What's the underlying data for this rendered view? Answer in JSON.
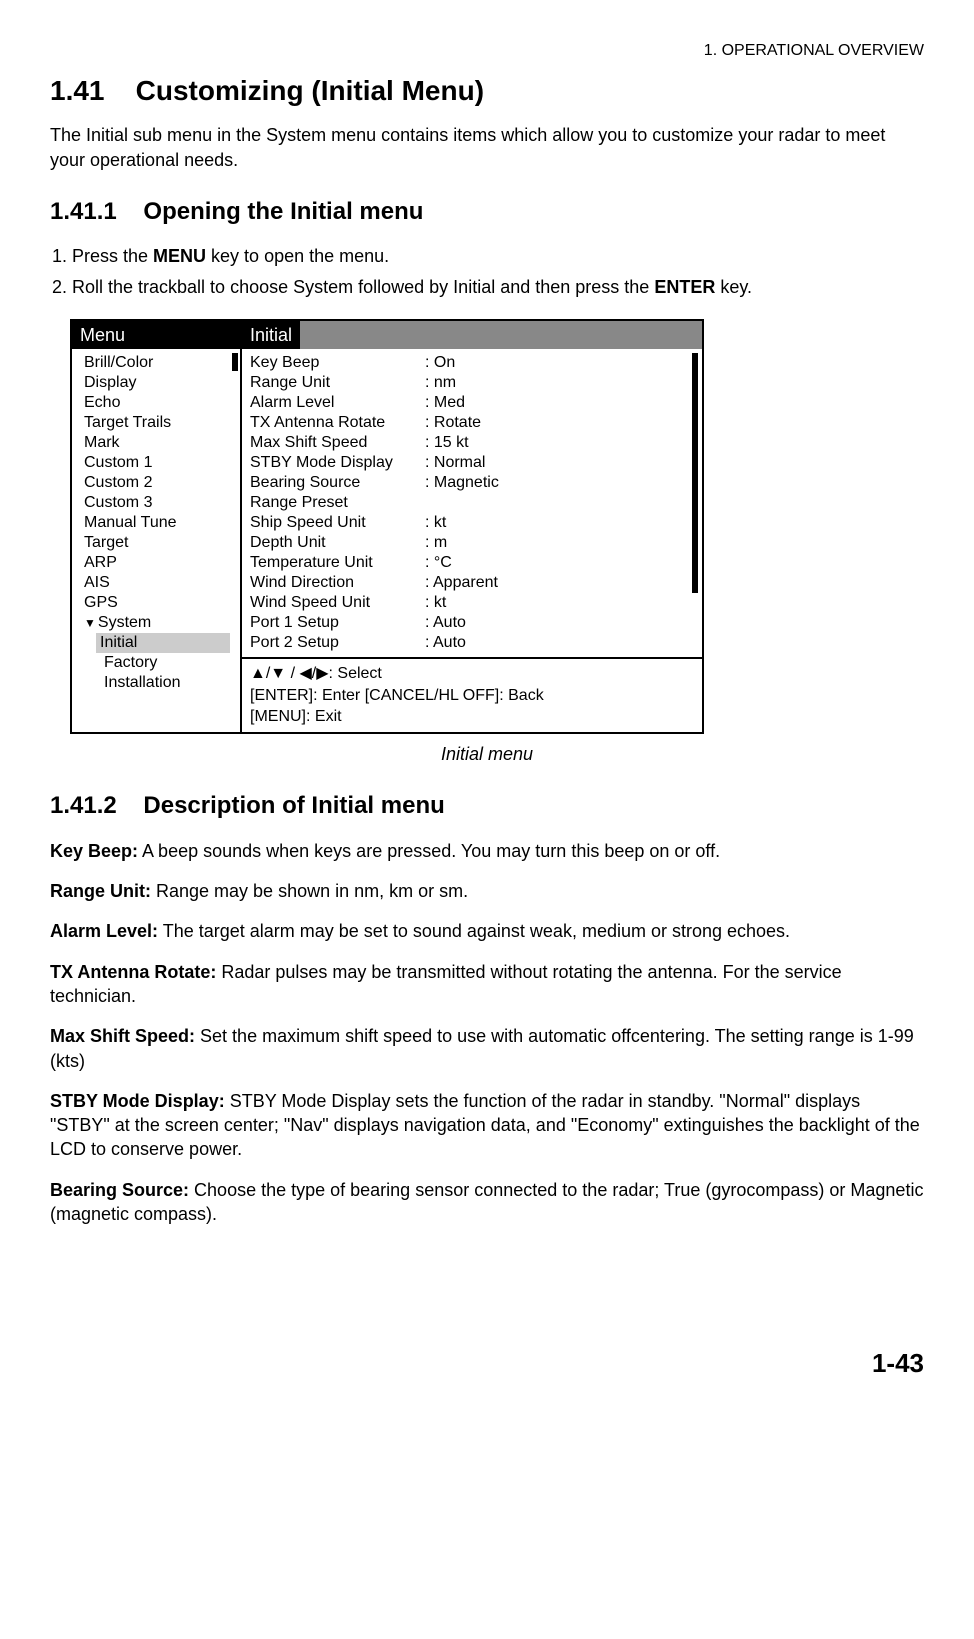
{
  "header": {
    "chapter": "1. OPERATIONAL OVERVIEW"
  },
  "section": {
    "number": "1.41",
    "title": "Customizing (Initial Menu)",
    "intro": "The Initial sub menu in the System menu contains items which allow you to customize your radar to meet your operational needs."
  },
  "sub1": {
    "number": "1.41.1",
    "title": "Opening the Initial menu",
    "step1_a": "Press the ",
    "step1_b": "MENU",
    "step1_c": " key to open the menu.",
    "step2_a": "Roll the trackball to choose System followed by Initial and then press the ",
    "step2_b": "ENTER",
    "step2_c": " key."
  },
  "menu": {
    "left_title": "Menu",
    "right_title": "Initial",
    "left_items": [
      "Brill/Color",
      "Display",
      "Echo",
      "Target Trails",
      "Mark",
      "Custom 1",
      "Custom 2",
      "Custom 3",
      "Manual Tune",
      "Target",
      "ARP",
      "AIS",
      "GPS"
    ],
    "system_label": "System",
    "sub_selected": "Initial",
    "sub_items": [
      "Factory",
      "Installation"
    ],
    "settings": [
      {
        "label": "Key Beep",
        "value": ": On"
      },
      {
        "label": "Range Unit",
        "value": ": nm"
      },
      {
        "label": "Alarm Level",
        "value": ": Med"
      },
      {
        "label": "TX Antenna Rotate",
        "value": ": Rotate"
      },
      {
        "label": "Max Shift Speed",
        "value": ": 15 kt"
      },
      {
        "label": "STBY Mode Display",
        "value": ": Normal"
      },
      {
        "label": "Bearing Source",
        "value": ": Magnetic"
      },
      {
        "label": "Range Preset",
        "value": ""
      },
      {
        "label": "Ship Speed Unit",
        "value": ": kt"
      },
      {
        "label": "Depth Unit",
        "value": ": m"
      },
      {
        "label": "Temperature Unit",
        "value": ": °C"
      },
      {
        "label": "Wind Direction",
        "value": ": Apparent"
      },
      {
        "label": "Wind Speed Unit",
        "value": ": kt"
      },
      {
        "label": "Port 1 Setup",
        "value": ": Auto"
      },
      {
        "label": "Port 2 Setup",
        "value": ": Auto"
      }
    ],
    "hints": {
      "line1": "▲/▼ / ◀/▶: Select",
      "line2": "[ENTER]: Enter  [CANCEL/HL OFF]: Back",
      "line3": "[MENU]: Exit"
    },
    "caption": "Initial menu"
  },
  "sub2": {
    "number": "1.41.2",
    "title": "Description of Initial menu",
    "items": [
      {
        "label": "Key Beep:",
        "text": " A beep sounds when keys are pressed. You may turn this beep on or off."
      },
      {
        "label": "Range Unit:",
        "text": " Range may be shown in nm, km or sm."
      },
      {
        "label": "Alarm Level:",
        "text": " The target alarm may be set to sound against weak, medium or strong echoes."
      },
      {
        "label": "TX Antenna Rotate:",
        "text": " Radar pulses may be transmitted without rotating the antenna. For the service technician."
      },
      {
        "label": "Max Shift Speed:",
        "text": " Set the maximum shift speed to use with automatic offcentering. The setting range is 1-99 (kts)"
      },
      {
        "label": "STBY Mode Display:",
        "text": " STBY Mode Display sets the function of the radar in standby. \"Normal\" displays \"STBY\" at the screen center; \"Nav\" displays navigation data, and \"Economy\" extinguishes the backlight of the LCD to conserve power."
      },
      {
        "label": "Bearing Source:",
        "text": " Choose the type of bearing sensor connected to the radar; True (gyrocompass) or Magnetic (magnetic compass)."
      }
    ]
  },
  "footer": {
    "page": "1-43"
  }
}
